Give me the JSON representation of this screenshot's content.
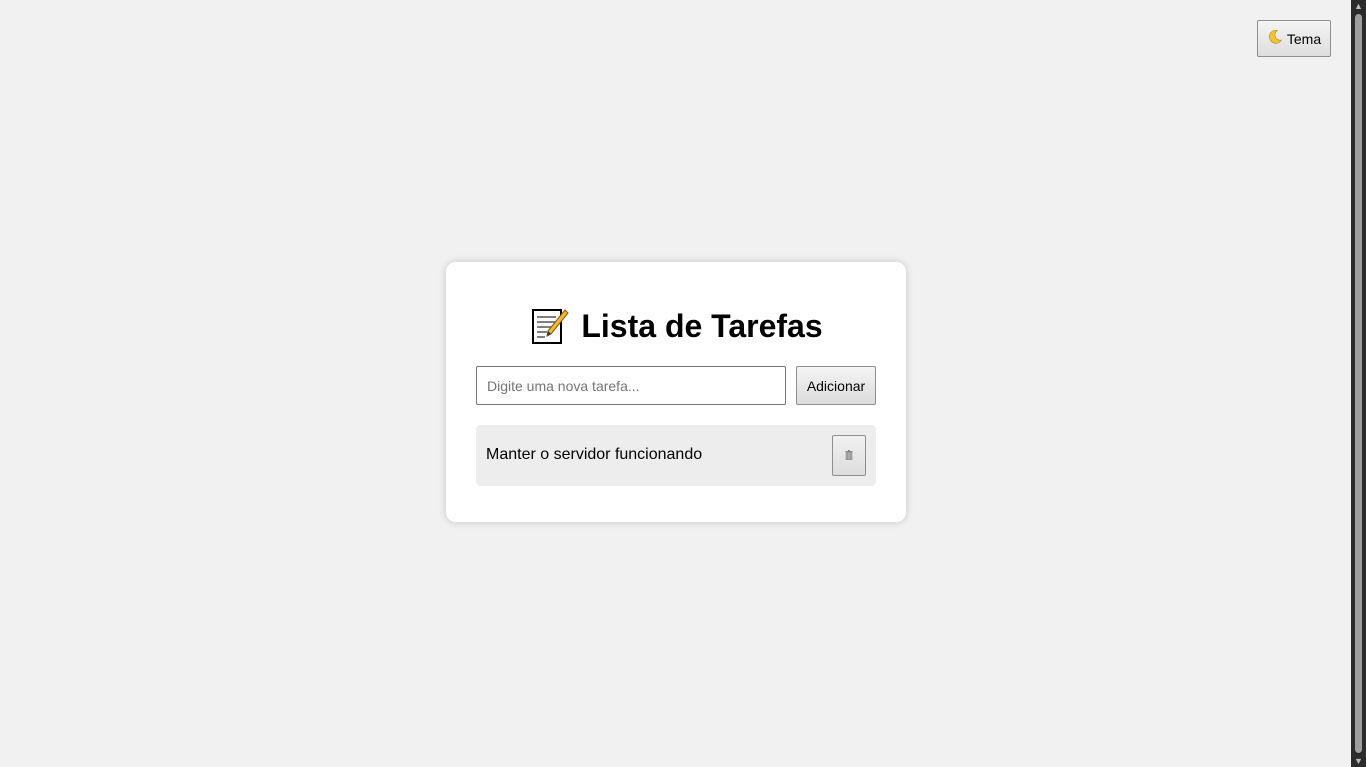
{
  "theme_button": {
    "icon": "crescent-moon-icon",
    "label": "Tema"
  },
  "card": {
    "title_icon": "memo-icon",
    "title": "Lista de Tarefas",
    "input": {
      "placeholder": "Digite uma nova tarefa...",
      "value": ""
    },
    "add_button_label": "Adicionar",
    "tasks": [
      {
        "text": "Manter o servidor funcionando",
        "delete_icon": "trash-icon"
      }
    ]
  },
  "colors": {
    "page_background": "#f1f1f1",
    "card_background": "#ffffff",
    "task_background": "#ededed"
  }
}
